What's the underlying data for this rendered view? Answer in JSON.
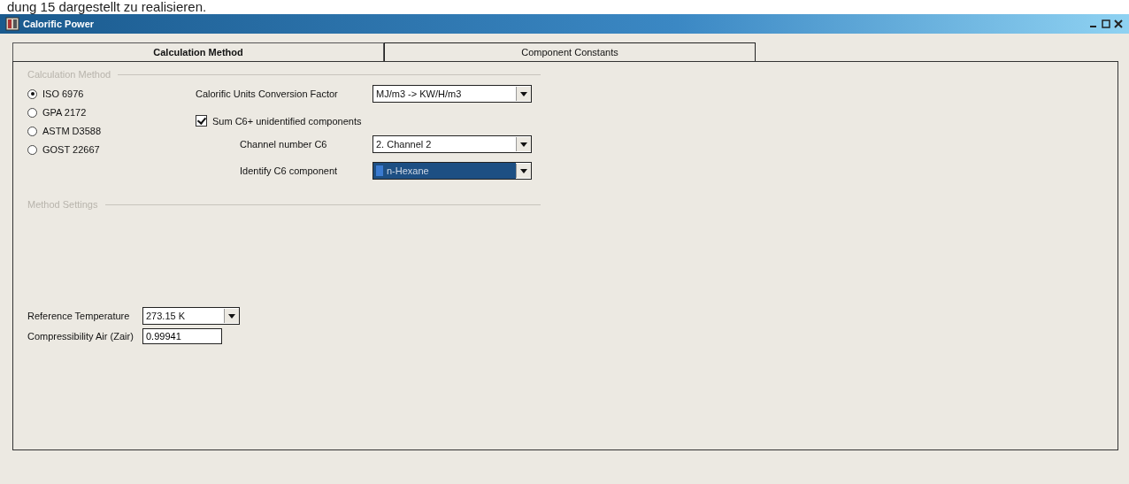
{
  "caption": "dung 15 dargestellt zu realisieren.",
  "window": {
    "title": "Calorific Power"
  },
  "tabs": [
    {
      "label": "Calculation Method",
      "selected": true
    },
    {
      "label": "Component Constants",
      "selected": false
    }
  ],
  "calculation_method": {
    "title": "Calculation Method",
    "options": [
      {
        "label": "ISO 6976",
        "selected": true
      },
      {
        "label": "GPA 2172",
        "selected": false
      },
      {
        "label": "ASTM D3588",
        "selected": false
      },
      {
        "label": "GOST 22667",
        "selected": false
      }
    ]
  },
  "conversion": {
    "label": "Calorific Units Conversion Factor",
    "value": "MJ/m3 -> KW/H/m3"
  },
  "sum_c6": {
    "label": "Sum C6+ unidentified components",
    "checked": true
  },
  "channel": {
    "label": "Channel number C6",
    "value": "2. Channel 2"
  },
  "identify": {
    "label": "Identify C6 component",
    "value": "n-Hexane",
    "selected": true
  },
  "method_settings": {
    "title": "Method Settings"
  },
  "reference_temperature": {
    "label": "Reference Temperature",
    "value": "273.15 K"
  },
  "compressibility": {
    "label": "Compressibility Air (Zair)",
    "value": "0.99941"
  }
}
